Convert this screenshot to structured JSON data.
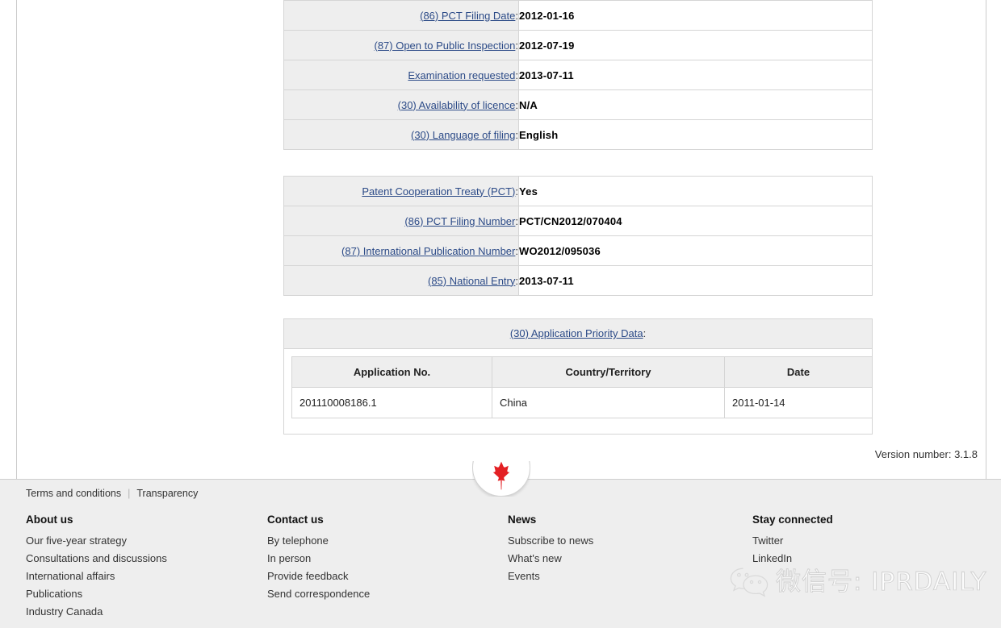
{
  "colors": {
    "link": "#2b4a87",
    "label_bg": "#eeeeee",
    "border": "#d5d5d5",
    "footer_bg": "#eeeeee",
    "leaf_red": "#e32024"
  },
  "bibliographic_table": {
    "rows": [
      {
        "label": "(86) PCT Filing Date",
        "value": "2012-01-16"
      },
      {
        "label": "(87) Open to Public Inspection",
        "value": "2012-07-19"
      },
      {
        "label": "Examination requested",
        "value": "2013-07-11"
      },
      {
        "label": "(30) Availability of licence",
        "value": "N/A"
      },
      {
        "label": "(30) Language of filing",
        "value": "English"
      }
    ]
  },
  "pct_table": {
    "rows": [
      {
        "label": "Patent Cooperation Treaty (PCT)",
        "value": "Yes"
      },
      {
        "label": "(86) PCT Filing Number",
        "value": "PCT/CN2012/070404"
      },
      {
        "label": "(87) International Publication Number",
        "value": "WO2012/095036"
      },
      {
        "label": "(85) National Entry",
        "value": "2013-07-11"
      }
    ]
  },
  "priority_data": {
    "heading": "(30) Application Priority Data",
    "columns": [
      "Application No.",
      "Country/Territory",
      "Date"
    ],
    "rows": [
      [
        "201110008186.1",
        "China",
        "2011-01-14"
      ]
    ]
  },
  "version": {
    "label": "Version number:",
    "value": "3.1.8"
  },
  "footer": {
    "top_links": [
      {
        "label": "Terms and conditions"
      },
      {
        "label": "Transparency"
      }
    ],
    "columns": [
      {
        "title": "About us",
        "items": [
          "Our five-year strategy",
          "Consultations and discussions",
          "International affairs",
          "Publications",
          "Industry Canada"
        ]
      },
      {
        "title": "Contact us",
        "items": [
          "By telephone",
          "In person",
          "Provide feedback",
          "Send correspondence"
        ]
      },
      {
        "title": "News",
        "items": [
          "Subscribe to news",
          "What's new",
          "Events"
        ]
      },
      {
        "title": "Stay connected",
        "items": [
          "Twitter",
          "LinkedIn"
        ]
      }
    ]
  },
  "watermark": {
    "text": "微信号: IPRDAILY"
  }
}
